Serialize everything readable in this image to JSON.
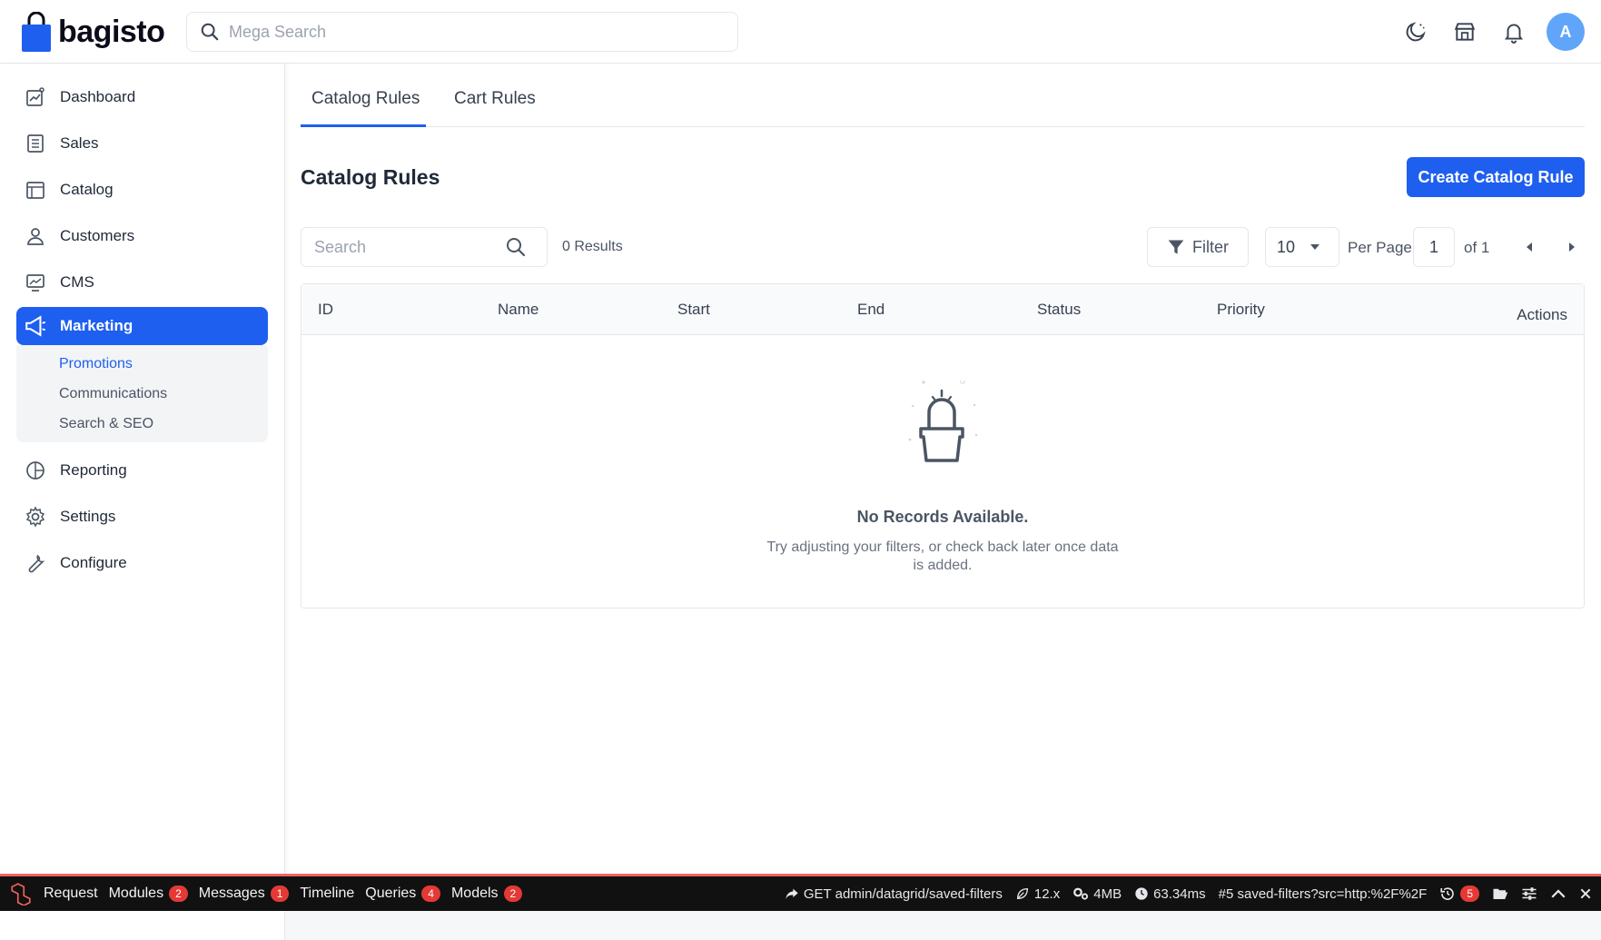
{
  "brand": {
    "name": "bagisto",
    "color": "#1e5ff0"
  },
  "header": {
    "search_placeholder": "Mega Search",
    "icons": [
      "dark-mode-icon",
      "storefront-icon",
      "notification-bell-icon"
    ],
    "avatar_initial": "A"
  },
  "sidebar": {
    "items": [
      {
        "label": "Dashboard",
        "icon": "dashboard-icon"
      },
      {
        "label": "Sales",
        "icon": "sales-icon"
      },
      {
        "label": "Catalog",
        "icon": "catalog-icon"
      },
      {
        "label": "Customers",
        "icon": "customers-icon"
      },
      {
        "label": "CMS",
        "icon": "cms-icon"
      },
      {
        "label": "Marketing",
        "icon": "megaphone-icon",
        "active": true
      },
      {
        "label": "Reporting",
        "icon": "pie-chart-icon"
      },
      {
        "label": "Settings",
        "icon": "gear-icon"
      },
      {
        "label": "Configure",
        "icon": "wrench-icon"
      }
    ],
    "submenu": [
      {
        "label": "Promotions",
        "current": true
      },
      {
        "label": "Communications"
      },
      {
        "label": "Search & SEO"
      }
    ]
  },
  "main": {
    "tabs": [
      {
        "label": "Catalog Rules",
        "active": true
      },
      {
        "label": "Cart Rules"
      }
    ],
    "title": "Catalog Rules",
    "create_button": "Create Catalog Rule",
    "search_placeholder": "Search",
    "results": "0 Results",
    "filter_label": "Filter",
    "per_page_value": "10",
    "per_page_label": "Per Page",
    "page_value": "1",
    "of_label": "of 1",
    "columns": [
      "ID",
      "Name",
      "Start",
      "End",
      "Status",
      "Priority",
      "Actions"
    ],
    "empty_title": "No Records Available.",
    "empty_desc": "Try adjusting your filters, or check back later once data is added."
  },
  "debugbar": {
    "tabs": [
      {
        "label": "Request"
      },
      {
        "label": "Modules",
        "count": "2"
      },
      {
        "label": "Messages",
        "count": "1"
      },
      {
        "label": "Timeline"
      },
      {
        "label": "Queries",
        "count": "4"
      },
      {
        "label": "Models",
        "count": "2"
      }
    ],
    "route": "GET admin/datagrid/saved-filters",
    "version": "12.x",
    "memory": "4MB",
    "time": "63.34ms",
    "request_id": "#5 saved-filters?src=http:%2F%2F",
    "history_count": "5"
  }
}
